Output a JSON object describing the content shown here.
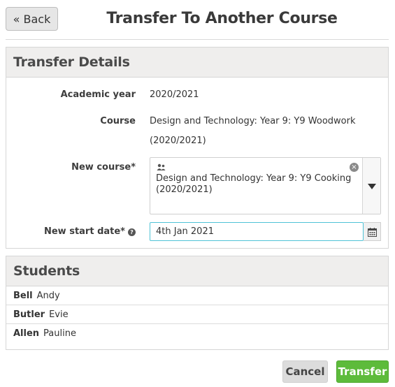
{
  "header": {
    "back_label": "« Back",
    "title": "Transfer To Another Course"
  },
  "details": {
    "heading": "Transfer Details",
    "academic_year_label": "Academic year",
    "academic_year_value": "2020/2021",
    "course_label": "Course",
    "course_value_line1": "Design and Technology: Year 9: Y9 Woodwork",
    "course_value_line2": "(2020/2021)",
    "new_course_label": "New course*",
    "new_course_value": "Design and Technology: Year 9: Y9 Cooking (2020/2021)",
    "new_start_date_label": "New start date*",
    "new_start_date_value": "4th Jan 2021"
  },
  "students": {
    "heading": "Students",
    "rows": [
      {
        "surname": "Bell",
        "forename": "Andy"
      },
      {
        "surname": "Butler",
        "forename": "Evie"
      },
      {
        "surname": "Allen",
        "forename": "Pauline"
      }
    ]
  },
  "actions": {
    "cancel_label": "Cancel",
    "transfer_label": "Transfer"
  },
  "colors": {
    "accent_green": "#5dbb3b",
    "focus_border": "#4fc3d6",
    "panel_header_bg": "#efeeed"
  },
  "icons": {
    "group": "people-icon",
    "clear": "clear-icon",
    "dropdown": "caret-down-icon",
    "calendar": "calendar-icon",
    "help": "help-icon"
  }
}
